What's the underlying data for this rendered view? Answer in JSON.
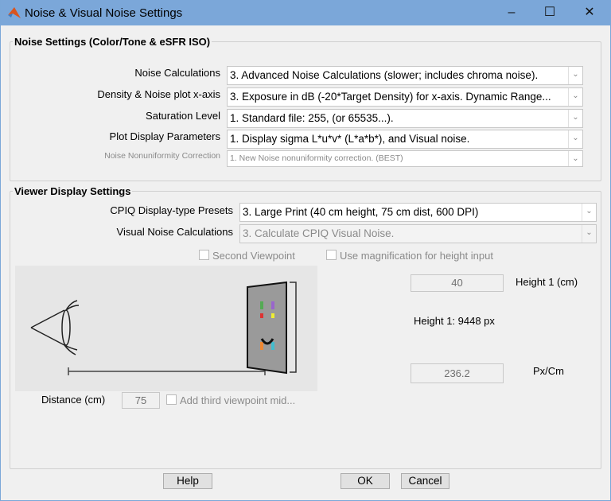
{
  "window": {
    "title": "Noise & Visual Noise Settings",
    "minimize": "–",
    "maximize": "☐",
    "close": "✕"
  },
  "noise": {
    "title": "Noise Settings (Color/Tone & eSFR ISO)",
    "rows": [
      {
        "label": "Noise Calculations",
        "value": "3. Advanced Noise Calculations (slower; includes chroma noise)."
      },
      {
        "label": "Density & Noise plot x-axis",
        "value": "3. Exposure in dB (-20*Target Density) for x-axis. Dynamic Range..."
      },
      {
        "label": "Saturation Level",
        "value": "1. Standard file: 255, (or 65535...)."
      },
      {
        "label": "Plot Display Parameters",
        "value": "1.  Display sigma L*u*v* (L*a*b*), and Visual noise."
      },
      {
        "label": "Noise Nonuniformity Correction",
        "value": "1. New Noise nonuniformity correction. (BEST)"
      }
    ]
  },
  "viewer": {
    "title": "Viewer Display Settings",
    "presets_label": "CPIQ Display-type Presets",
    "presets_value": "3. Large Print (40 cm height, 75 cm dist, 600 DPI)",
    "vn_label": "Visual Noise Calculations",
    "vn_value": "3. Calculate CPIQ Visual Noise.",
    "second_viewpoint": "Second Viewpoint",
    "use_magnification": "Use magnification for height input",
    "distance_label": "Distance (cm)",
    "distance_value": "75",
    "third_viewpoint": "Add third viewpoint mid...",
    "height_value": "40",
    "height_label": "Height 1 (cm)",
    "height_px": "Height 1: 9448 px",
    "pxcm_value": "236.2",
    "pxcm_label": "Px/Cm"
  },
  "buttons": {
    "help": "Help",
    "ok": "OK",
    "cancel": "Cancel"
  },
  "arrow": "⌄"
}
